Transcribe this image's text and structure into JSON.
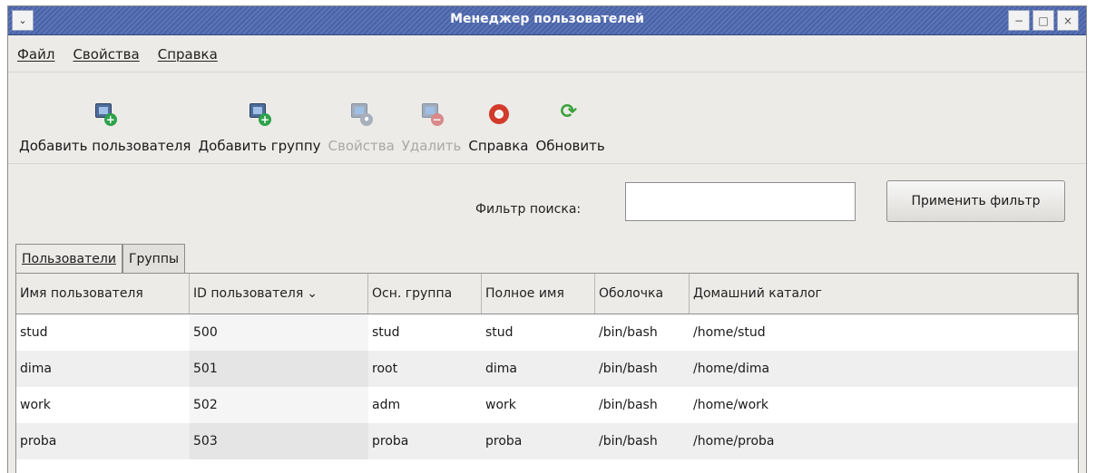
{
  "window": {
    "title": "Менеджер пользователей",
    "menu_glyph": "⌄",
    "controls": [
      "−",
      "□",
      "×"
    ]
  },
  "menu": [
    {
      "label": "Файл"
    },
    {
      "label": "Свойства"
    },
    {
      "label": "Справка"
    }
  ],
  "toolbar": {
    "add_user": "Добавить пользователя",
    "add_group": "Добавить группу",
    "properties": "Свойства",
    "delete": "Удалить",
    "help": "Справка",
    "refresh": "Обновить"
  },
  "filter": {
    "label": "Фильтр поиска:",
    "value": "",
    "apply_button": "Применить фильтр"
  },
  "tabs": [
    {
      "label": "Пользователи",
      "active": true
    },
    {
      "label": "Группы",
      "active": false
    }
  ],
  "table": {
    "columns": [
      "Имя пользователя",
      "ID пользователя",
      "Осн. группа",
      "Полное имя",
      "Оболочка",
      "Домашний каталог"
    ],
    "sort_glyph": "⌄",
    "rows": [
      [
        "stud",
        "500",
        "stud",
        "stud",
        "/bin/bash",
        "/home/stud"
      ],
      [
        "dima",
        "501",
        "root",
        "dima",
        "/bin/bash",
        "/home/dima"
      ],
      [
        "work",
        "502",
        "adm",
        "work",
        "/bin/bash",
        "/home/work"
      ],
      [
        "proba",
        "503",
        "proba",
        "proba",
        "/bin/bash",
        "/home/proba"
      ]
    ]
  }
}
